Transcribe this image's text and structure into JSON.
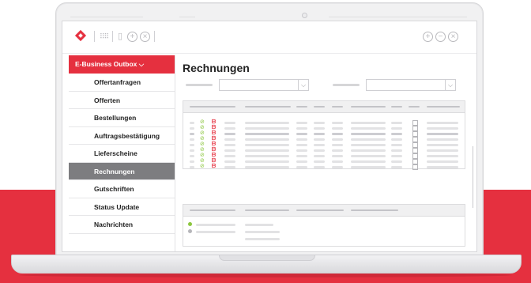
{
  "colors": {
    "brand_red": "#e5303f",
    "active_item": "#7d7d80",
    "status_green": "#8cc63f"
  },
  "toolbar": {
    "left_icons": [
      "app-logo-icon",
      "grid-icon",
      "document-icon",
      "add-circle-icon",
      "close-circle-icon"
    ],
    "right_icons": [
      "add-circle-icon",
      "remove-circle-icon",
      "close-circle-icon"
    ]
  },
  "sidebar": {
    "header": "E-Business Outbox ⌵",
    "items": [
      {
        "label": "Offertanfragen",
        "active": false
      },
      {
        "label": "Offerten",
        "active": false
      },
      {
        "label": "Bestellungen",
        "active": false
      },
      {
        "label": "Auftragsbestätigung",
        "active": false
      },
      {
        "label": "Lieferscheine",
        "active": false
      },
      {
        "label": "Rechnungen",
        "active": true
      },
      {
        "label": "Gutschriften",
        "active": false
      },
      {
        "label": "Status Update",
        "active": false
      },
      {
        "label": "Nachrichten",
        "active": false
      }
    ]
  },
  "main": {
    "title": "Rechnungen",
    "filters": [
      {
        "arrow": "⌵"
      },
      {
        "arrow": "⌵"
      }
    ],
    "table": {
      "row_count": 9,
      "row_icons": [
        "check-circle-icon",
        "pdf-document-icon"
      ]
    },
    "detail": {
      "row_count": 2
    }
  }
}
